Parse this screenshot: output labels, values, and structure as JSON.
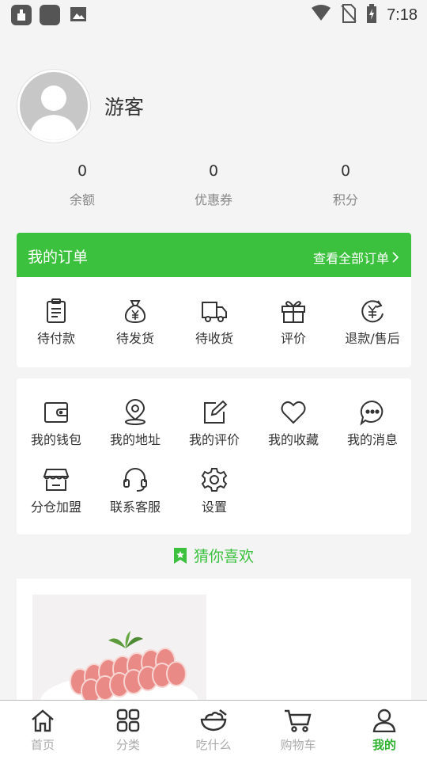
{
  "status_bar": {
    "time": "7:18"
  },
  "profile": {
    "username": "游客"
  },
  "stats": [
    {
      "value": "0",
      "label": "余额"
    },
    {
      "value": "0",
      "label": "优惠券"
    },
    {
      "value": "0",
      "label": "积分"
    }
  ],
  "orders": {
    "title": "我的订单",
    "view_all": "查看全部订单",
    "items": [
      {
        "label": "待付款",
        "icon": "clipboard-icon"
      },
      {
        "label": "待发货",
        "icon": "money-bag-icon"
      },
      {
        "label": "待收货",
        "icon": "truck-icon"
      },
      {
        "label": "评价",
        "icon": "gift-icon"
      },
      {
        "label": "退款/售后",
        "icon": "refund-icon"
      }
    ]
  },
  "services": {
    "items": [
      {
        "label": "我的钱包",
        "icon": "wallet-icon"
      },
      {
        "label": "我的地址",
        "icon": "location-icon"
      },
      {
        "label": "我的评价",
        "icon": "edit-icon"
      },
      {
        "label": "我的收藏",
        "icon": "heart-icon"
      },
      {
        "label": "我的消息",
        "icon": "message-icon"
      },
      {
        "label": "分仓加盟",
        "icon": "store-icon"
      },
      {
        "label": "联系客服",
        "icon": "headset-icon"
      },
      {
        "label": "设置",
        "icon": "settings-icon"
      }
    ]
  },
  "recommend": {
    "title": "猜你喜欢"
  },
  "tabbar": {
    "active": "我的",
    "tabs": [
      {
        "label": "首页",
        "icon": "home-icon"
      },
      {
        "label": "分类",
        "icon": "grid-icon"
      },
      {
        "label": "吃什么",
        "icon": "bowl-icon"
      },
      {
        "label": "购物车",
        "icon": "cart-icon"
      },
      {
        "label": "我的",
        "icon": "user-icon"
      }
    ]
  },
  "colors": {
    "accent": "#3cc13e",
    "tab_active": "#2fb22f",
    "tab_inactive": "#aaaaaa"
  }
}
